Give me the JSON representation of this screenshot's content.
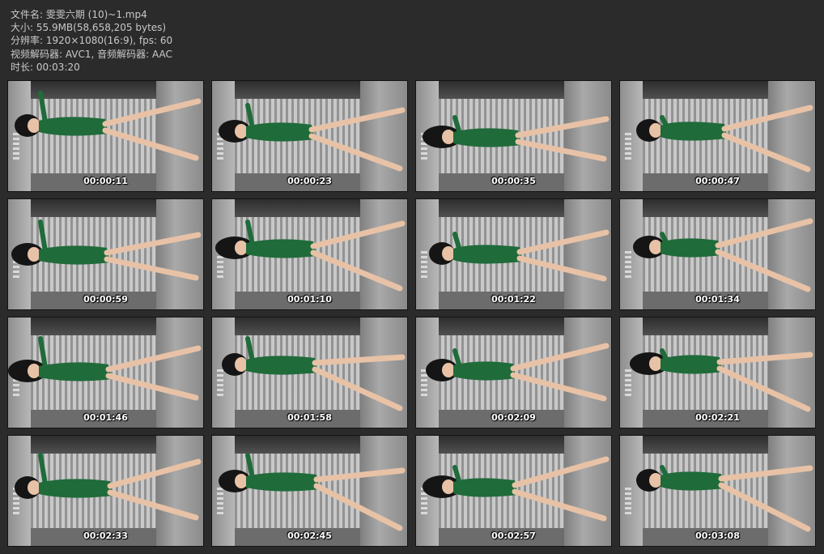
{
  "info": {
    "filename": "文件名: 雯雯六期 (10)~1.mp4",
    "size": "大小: 55.9MB(58,658,205 bytes)",
    "resolution": "分辨率: 1920×1080(16:9), fps: 60",
    "codec": "视频解码器: AVC1, 音频解码器: AAC",
    "duration": "时长: 00:03:20"
  },
  "thumbnails": [
    {
      "timestamp": "00:00:11"
    },
    {
      "timestamp": "00:00:23"
    },
    {
      "timestamp": "00:00:35"
    },
    {
      "timestamp": "00:00:47"
    },
    {
      "timestamp": "00:00:59"
    },
    {
      "timestamp": "00:01:10"
    },
    {
      "timestamp": "00:01:22"
    },
    {
      "timestamp": "00:01:34"
    },
    {
      "timestamp": "00:01:46"
    },
    {
      "timestamp": "00:01:58"
    },
    {
      "timestamp": "00:02:09"
    },
    {
      "timestamp": "00:02:21"
    },
    {
      "timestamp": "00:02:33"
    },
    {
      "timestamp": "00:02:45"
    },
    {
      "timestamp": "00:02:57"
    },
    {
      "timestamp": "00:03:08"
    }
  ],
  "colors": {
    "background": "#2b2b2b",
    "info_text": "#c9c9c9",
    "outfit_green": "#1f6b3a",
    "skin": "#e8c2a6",
    "hair": "#151515"
  }
}
